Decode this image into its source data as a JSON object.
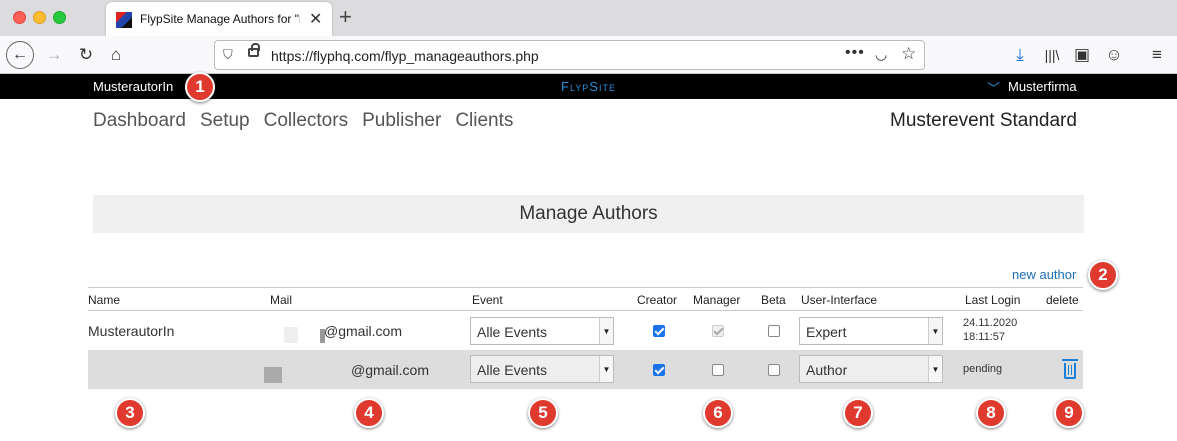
{
  "browser": {
    "tab_title": "FlypSite Manage Authors for \"m",
    "url": "https://flyphq.com/flyp_manageauthors.php"
  },
  "site_header": {
    "user": "MusterautorIn",
    "brand": "FlypSite",
    "company": "Musterfirma"
  },
  "nav": {
    "items": [
      "Dashboard",
      "Setup",
      "Collectors",
      "Publisher",
      "Clients"
    ],
    "event": "Musterevent Standard"
  },
  "page": {
    "title": "Manage Authors",
    "new_author": "new author"
  },
  "table": {
    "headers": {
      "name": "Name",
      "mail": "Mail",
      "event": "Event",
      "creator": "Creator",
      "manager": "Manager",
      "beta": "Beta",
      "ui": "User-Interface",
      "last_login": "Last Login",
      "delete": "delete"
    },
    "rows": [
      {
        "name": "MusterautorIn",
        "mail": "@gmail.com",
        "event": "Alle Events",
        "creator": true,
        "manager": true,
        "beta": false,
        "ui": "Expert",
        "last_login_date": "24.11.2020",
        "last_login_time": "18:11:57"
      },
      {
        "name": "",
        "mail": "@gmail.com",
        "event": "Alle Events",
        "creator": true,
        "manager": false,
        "beta": false,
        "ui": "Author",
        "last_login": "pending"
      }
    ]
  },
  "badges": [
    "1",
    "2",
    "3",
    "4",
    "5",
    "6",
    "7",
    "8",
    "9"
  ],
  "colors": {
    "accent": "#2b8fd6",
    "badge": "#e03a2f",
    "link": "#1a6fb7"
  }
}
